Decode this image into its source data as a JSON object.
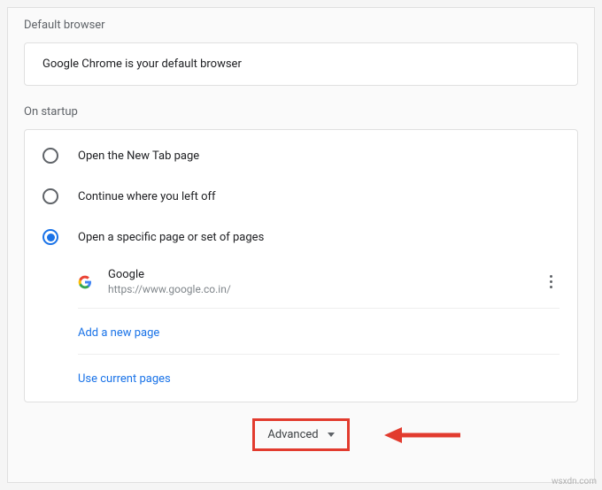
{
  "sections": {
    "defaultBrowser": {
      "title": "Default browser",
      "message": "Google Chrome is your default browser"
    },
    "onStartup": {
      "title": "On startup",
      "options": [
        {
          "label": "Open the New Tab page",
          "selected": false
        },
        {
          "label": "Continue where you left off",
          "selected": false
        },
        {
          "label": "Open a specific page or set of pages",
          "selected": true
        }
      ],
      "pages": [
        {
          "title": "Google",
          "url": "https://www.google.co.in/"
        }
      ],
      "addPageLabel": "Add a new page",
      "useCurrentLabel": "Use current pages"
    }
  },
  "advancedLabel": "Advanced",
  "watermark": "wsxdn.com"
}
